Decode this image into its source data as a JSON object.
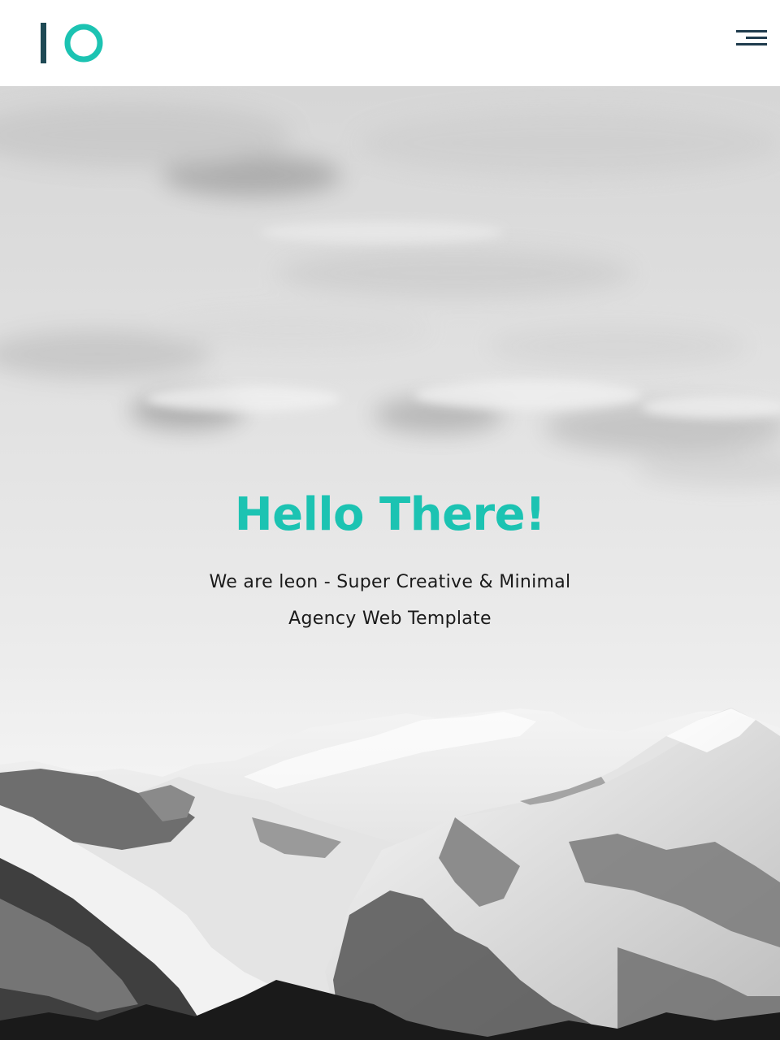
{
  "header": {
    "logo_text": "IO",
    "logo_colors": {
      "bar": "#1f4a55",
      "ring": "#1cc3b2"
    },
    "menu_icon": "hamburger-menu-icon"
  },
  "hero": {
    "background": "monochrome snowy mountain landscape under cloudy sky",
    "title": "Hello There!",
    "subtitle": "We are leon - Super Creative & Minimal Agency Web Template",
    "title_color": "#1cc3b2"
  }
}
